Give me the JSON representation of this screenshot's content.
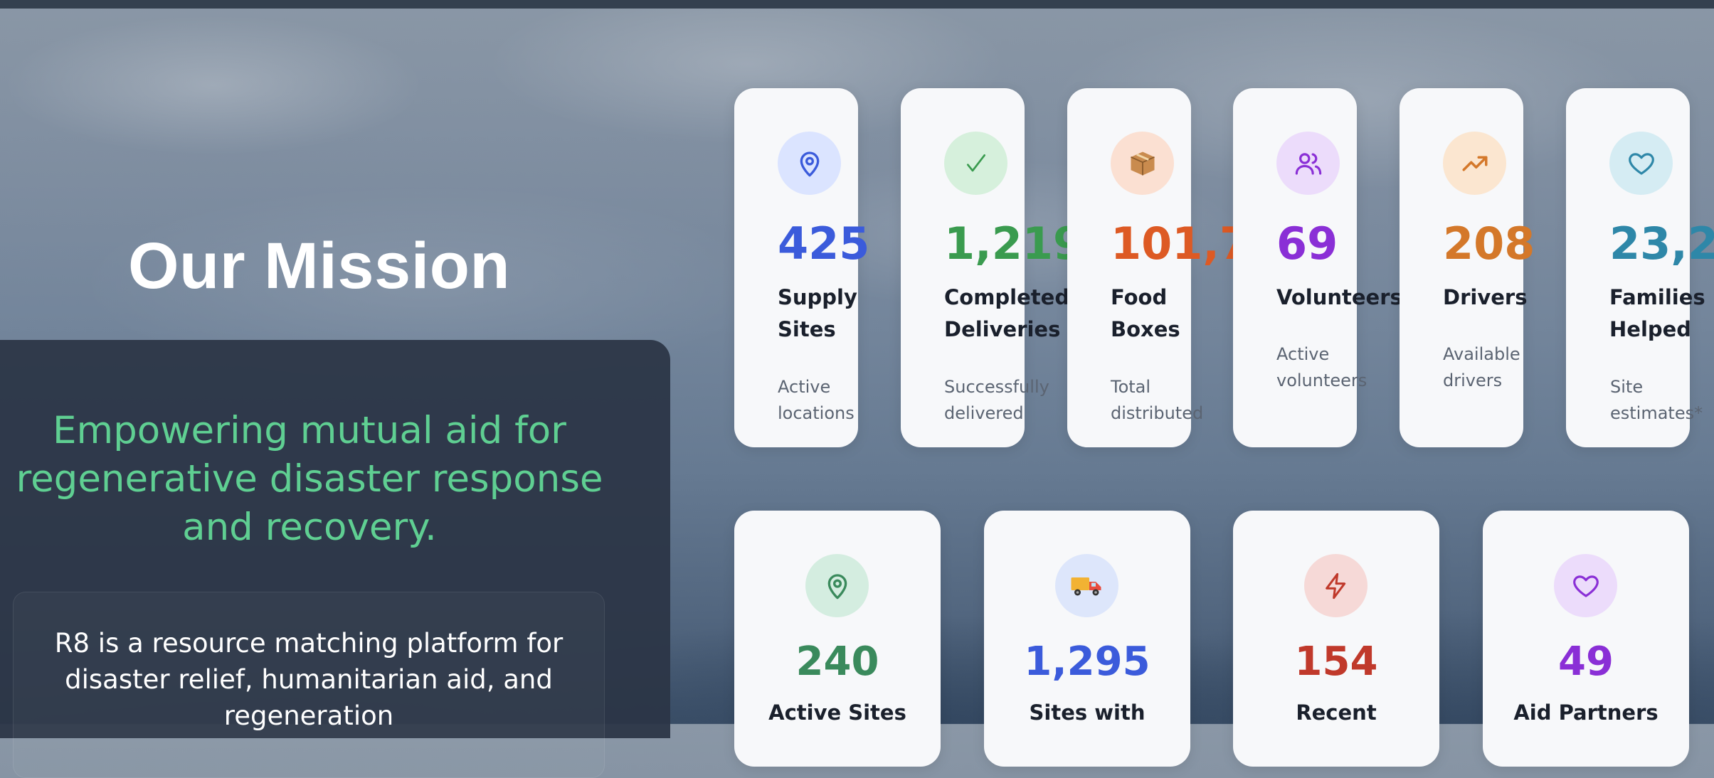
{
  "mission": {
    "title": "Our Mission",
    "tagline": "Empowering mutual aid for regenerative disaster response and recovery.",
    "description": "R8 is a resource matching platform for disaster relief, humanitarian aid, and regeneration"
  },
  "stats_row1": [
    {
      "value": "425",
      "label": "Supply Sites",
      "subtitle": "Active locations",
      "icon": "map-pin-icon",
      "color": "#3b5bdb",
      "bg": "#dbe4ff"
    },
    {
      "value": "1,219",
      "label": "Completed Deliveries",
      "subtitle": "Successfully delivered",
      "icon": "checkmark-icon",
      "color": "#3a9b4f",
      "bg": "#d6f0dc"
    },
    {
      "value": "101,7",
      "label": "Food Boxes",
      "subtitle": "Total distributed",
      "icon": "package-icon",
      "color": "#dd5a24",
      "bg": "#fbe0d2"
    },
    {
      "value": "69",
      "label": "Volunteers",
      "subtitle": "Active volunteers",
      "icon": "users-icon",
      "color": "#8a2fd6",
      "bg": "#ecdcfb"
    },
    {
      "value": "208",
      "label": "Drivers",
      "subtitle": "Available drivers",
      "icon": "trending-up-icon",
      "color": "#d4782a",
      "bg": "#fbe6d0"
    },
    {
      "value": "23,2",
      "label": "Families Helped",
      "subtitle": "Site estimates*",
      "icon": "heart-icon",
      "color": "#2e87a8",
      "bg": "#d5ecf3"
    }
  ],
  "stats_row2": [
    {
      "value": "240",
      "label": "Active Sites",
      "icon": "map-pin-icon",
      "color": "#3a8a5c",
      "bg": "#d4ede0"
    },
    {
      "value": "1,295",
      "label": "Sites with",
      "icon": "delivery-truck-icon",
      "color": "#3b5bdb",
      "bg": "#dde6fb"
    },
    {
      "value": "154",
      "label": "Recent",
      "icon": "lightning-icon",
      "color": "#c0392b",
      "bg": "#f6d9d7"
    },
    {
      "value": "49",
      "label": "Aid Partners",
      "icon": "heart-icon",
      "color": "#8a2fd6",
      "bg": "#ecdcfb"
    }
  ]
}
